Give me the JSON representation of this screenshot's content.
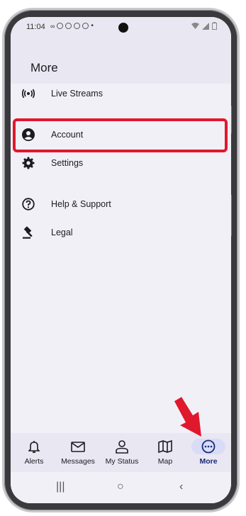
{
  "status_bar": {
    "time": "11:04"
  },
  "header": {
    "title": "More"
  },
  "menu": [
    {
      "label": "Live Streams",
      "icon": "live-streams-icon"
    },
    {
      "label": "Account",
      "icon": "account-icon"
    },
    {
      "label": "Settings",
      "icon": "gear-icon"
    },
    {
      "label": "Help & Support",
      "icon": "help-icon"
    },
    {
      "label": "Legal",
      "icon": "gavel-icon"
    }
  ],
  "bottom_nav": [
    {
      "label": "Alerts",
      "icon": "bell-icon"
    },
    {
      "label": "Messages",
      "icon": "mail-icon"
    },
    {
      "label": "My Status",
      "icon": "person-icon"
    },
    {
      "label": "Map",
      "icon": "map-icon"
    },
    {
      "label": "More",
      "icon": "more-icon",
      "active": true
    }
  ],
  "system_nav": {
    "recents": "|||",
    "home": "○",
    "back": "‹"
  },
  "colors": {
    "highlight": "#e0182d",
    "active_nav": "#1a2a7a",
    "active_pill": "#d8dcf6"
  }
}
